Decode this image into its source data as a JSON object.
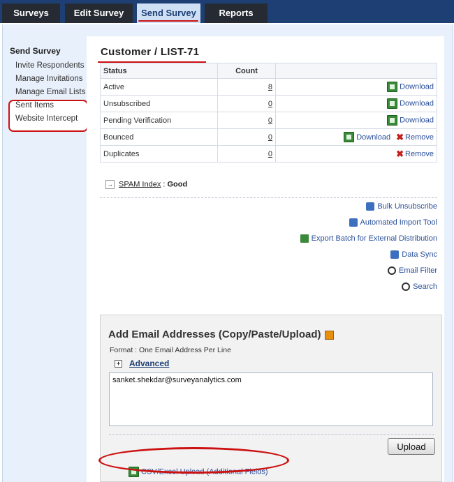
{
  "tabs": [
    {
      "label": "Surveys"
    },
    {
      "label": "Edit Survey"
    },
    {
      "label": "Send Survey"
    },
    {
      "label": "Reports"
    }
  ],
  "sidebar": {
    "title": "Send Survey",
    "items": [
      {
        "label": "Invite Respondents"
      },
      {
        "label": "Manage Invitations"
      },
      {
        "label": "Manage Email Lists"
      },
      {
        "label": "Sent Items"
      },
      {
        "label": "Website Intercept"
      }
    ]
  },
  "main": {
    "title": "Customer / LIST-71",
    "table": {
      "headers": [
        "Status",
        "Count"
      ],
      "rows": [
        {
          "status": "Active",
          "count": "8",
          "download": "Download",
          "remove": ""
        },
        {
          "status": "Unsubscribed",
          "count": "0",
          "download": "Download",
          "remove": ""
        },
        {
          "status": "Pending Verification",
          "count": "0",
          "download": "Download",
          "remove": ""
        },
        {
          "status": "Bounced",
          "count": "0",
          "download": "Download",
          "remove": "Remove"
        },
        {
          "status": "Duplicates",
          "count": "0",
          "download": "",
          "remove": "Remove"
        }
      ]
    },
    "spam": {
      "label": "SPAM Index",
      "separator": " : ",
      "value": "Good"
    },
    "tools": [
      {
        "label": "Bulk Unsubscribe",
        "icon": "bulk-unsubscribe-icon"
      },
      {
        "label": "Automated Import Tool",
        "icon": "import-tool-icon"
      },
      {
        "label": "Export Batch for External Distribution",
        "icon": "excel-icon"
      },
      {
        "label": "Data Sync",
        "icon": "data-sync-icon"
      },
      {
        "label": "Email Filter",
        "icon": "magnifier-icon"
      },
      {
        "label": "Search",
        "icon": "magnifier-icon"
      }
    ],
    "add": {
      "title": "Add Email Addresses (Copy/Paste/Upload)",
      "format": "Format : One Email Address Per Line",
      "advanced": "Advanced",
      "textarea_value": "sanket.shekdar@surveyanalytics.com",
      "upload": "Upload",
      "csv": "CSV/Excel Upload (Additional Fields)"
    }
  }
}
